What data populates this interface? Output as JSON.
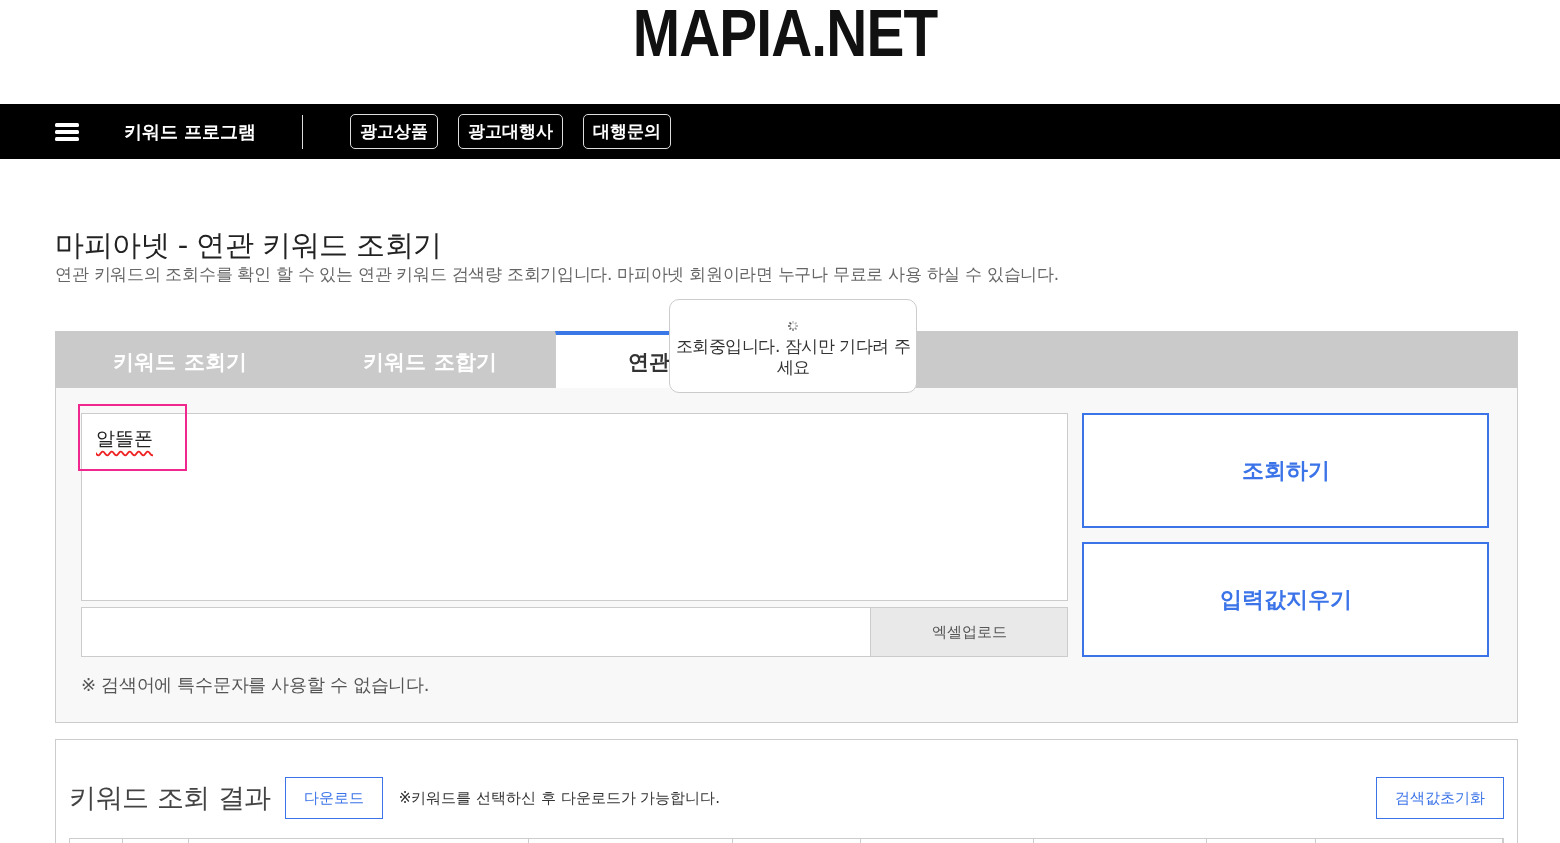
{
  "logo": "MAPIA.NET",
  "nav": {
    "title": "키워드 프로그램",
    "links": [
      "광고상품",
      "광고대행사",
      "대행문의"
    ]
  },
  "page": {
    "title": "마피아넷 - 연관 키워드 조회기",
    "subtitle": "연관 키워드의 조회수를 확인 할 수 있는 연관 키워드 검색량 조회기입니다. 마피아넷 회원이라면 누구나 무료로 사용 하실 수 있습니다."
  },
  "tabs": [
    {
      "label": "키워드 조회기",
      "selected": false
    },
    {
      "label": "키워드 조합기",
      "selected": false
    },
    {
      "label": "연관",
      "selected": true
    }
  ],
  "loading_popup": {
    "message": "조회중입니다. 잠시만 기다려 주세요"
  },
  "keyword_input": {
    "value": "알뜰폰",
    "highlighted": true
  },
  "upload_button": "엑셀업로드",
  "search_button": "조회하기",
  "clear_button": "입력값지우기",
  "notice": "※ 검색어에 특수문자를 사용할 수 없습니다.",
  "results": {
    "title": "키워드 조회 결과",
    "download_button": "다운로드",
    "hint": "※키워드를 선택하신 후 다운로드가 가능합니다.",
    "reset_button": "검색값초기화"
  }
}
